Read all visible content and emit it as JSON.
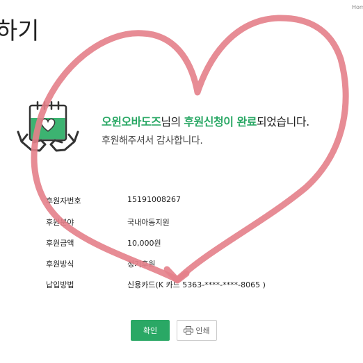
{
  "header": {
    "nav_home": "Hom",
    "title": "하기"
  },
  "message": {
    "name": "오윈오바도즈",
    "particle": "님의 ",
    "highlight": "후원신청이 완료",
    "suffix": "되었습니다.",
    "thanks": "후원해주셔서 감사합니다."
  },
  "details": [
    {
      "label": "후원자번호",
      "value": "15191008267"
    },
    {
      "label": "후원분야",
      "value": "국내아동지원"
    },
    {
      "label": "후원금액",
      "value": "10,000원"
    },
    {
      "label": "후원방식",
      "value": "정기후원"
    },
    {
      "label": "납입방법",
      "value": "신용카드(K 카드 5363-****-****-8065 )"
    }
  ],
  "buttons": {
    "confirm": "확인",
    "print": "인쇄"
  },
  "colors": {
    "accent_green": "#2aa865",
    "heart_stroke": "#e47f8a"
  },
  "icons": {
    "hero": "calendar-heart-hands-icon",
    "print": "printer-icon"
  }
}
